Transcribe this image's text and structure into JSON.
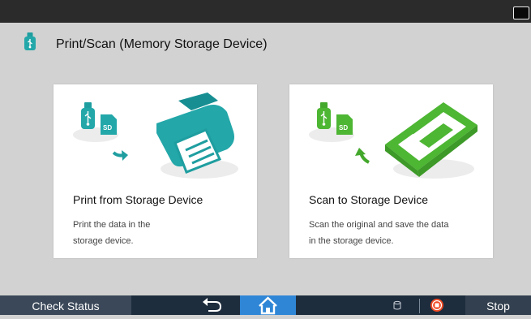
{
  "header": {
    "title": "Print/Scan (Memory Storage Device)",
    "icon": "usb-icon"
  },
  "top_bar": {
    "sleep_icon": "moon-icon"
  },
  "cards": [
    {
      "title": "Print from Storage Device",
      "description_line1": "Print the data in the",
      "description_line2": "storage device.",
      "icons": [
        "usb-icon",
        "sd-card-icon",
        "arrow-icon",
        "printer-icon"
      ],
      "accent_color": "#23a7a9"
    },
    {
      "title": "Scan to Storage Device",
      "description_line1": "Scan the original and save the data",
      "description_line2": "in the storage device.",
      "icons": [
        "usb-icon",
        "sd-card-icon",
        "arrow-icon",
        "scanner-icon"
      ],
      "accent_color": "#4db633"
    }
  ],
  "sd_label": "SD",
  "bottom_bar": {
    "check_status": "Check Status",
    "stop": "Stop",
    "icons": [
      "back-icon",
      "home-icon",
      "data-indicator-icon",
      "stop-icon"
    ],
    "home_color": "#2f86d6"
  }
}
